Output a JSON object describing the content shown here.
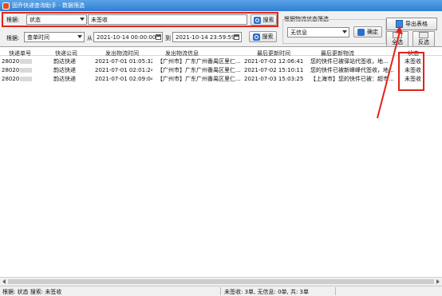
{
  "window": {
    "title": "固乔快递查询助手 - 数据筛选"
  },
  "filter": {
    "by_label": "根据:",
    "field_selected": "状态",
    "keyword": "未签收",
    "search_label": "搜索"
  },
  "date_filter": {
    "by_label": "根据:",
    "field_selected": "查单时间",
    "from_label": "从",
    "from_value": "2021-10-14 00:00:00",
    "to_label": "到",
    "to_value": "2021-10-14 23:59:59",
    "search_label": "搜索"
  },
  "status_filter": {
    "group_title": "根据物流状态筛选",
    "selected": "无信息",
    "confirm_label": "确定"
  },
  "actions": {
    "export_label": "导出表格",
    "select_all_label": "全选",
    "invert_label": "反选"
  },
  "table": {
    "columns": [
      "快递单号",
      "快递公司",
      "发出物流时间",
      "发出物流信息",
      "最后更新时间",
      "最后更新物流",
      "状态"
    ],
    "rows": [
      {
        "tracking_no": "28020",
        "company": "韵达快递",
        "sent_time": "2021-07-01 01:05:32",
        "sent_info": "【广州市】广东广州番禺区里仁...",
        "last_time": "2021-07-02 12:06:41",
        "last_info": "您的快件已被驿站代签收，地...",
        "status": "未签收"
      },
      {
        "tracking_no": "28020",
        "company": "韵达快递",
        "sent_time": "2021-07-01 02:01:24",
        "sent_info": "【广州市】广东广州番禺区里仁...",
        "last_time": "2021-07-02 15:10:11",
        "last_info": "您的快件已被新峰峰代签收，地...",
        "status": "未签收"
      },
      {
        "tracking_no": "28020",
        "company": "韵达快递",
        "sent_time": "2021-07-01 02:09:04",
        "sent_info": "【广州市】广东广州番禺区里仁...",
        "last_time": "2021-07-03 15:03:25",
        "last_info": "【上海市】您的快件已被：超市...",
        "status": "未签收"
      }
    ]
  },
  "statusbar": {
    "left": "根据: 状态  搜索: 未签收",
    "right": "未签收: 3单, 无信息: 0单, 共: 3单"
  },
  "colors": {
    "highlight": "#e0241b",
    "titlebar": "#2f7fd1"
  }
}
